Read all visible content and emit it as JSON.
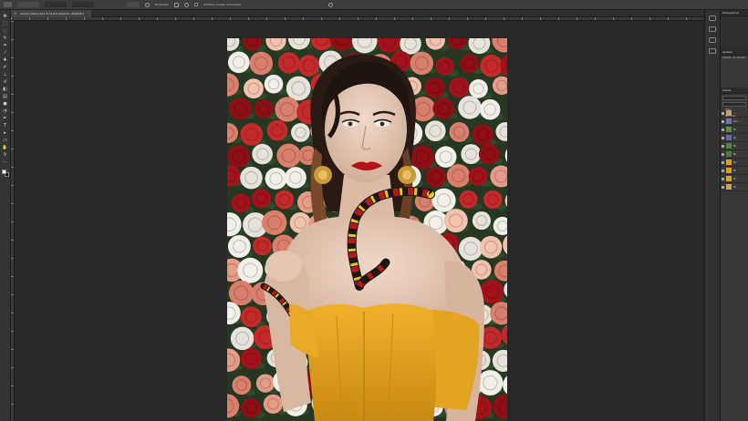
{
  "options_bar": {
    "tool_preset_label": "Proporción",
    "select_label": "Borrar",
    "straighten_label": "Enderezar",
    "checkbox_label": "Eliminar píxeles recortados"
  },
  "document": {
    "tab_title": "primer planos.psd al 33,4% (textura, RGB/16*)"
  },
  "tools": [
    {
      "icon": "move-icon",
      "glyph": "✥"
    },
    {
      "icon": "marquee-icon",
      "glyph": "⬚"
    },
    {
      "icon": "lasso-icon",
      "glyph": "◌"
    },
    {
      "icon": "quick-select-icon",
      "glyph": "✎"
    },
    {
      "icon": "crop-icon",
      "glyph": "⌗"
    },
    {
      "icon": "eyedropper-icon",
      "glyph": "⁄"
    },
    {
      "icon": "healing-icon",
      "glyph": "✚"
    },
    {
      "icon": "brush-icon",
      "glyph": "✐"
    },
    {
      "icon": "stamp-icon",
      "glyph": "⊥"
    },
    {
      "icon": "history-brush-icon",
      "glyph": "↺"
    },
    {
      "icon": "eraser-icon",
      "glyph": "◧"
    },
    {
      "icon": "gradient-icon",
      "glyph": "▤"
    },
    {
      "icon": "blur-icon",
      "glyph": "●"
    },
    {
      "icon": "dodge-icon",
      "glyph": "◔"
    },
    {
      "icon": "pen-icon",
      "glyph": "✒"
    },
    {
      "icon": "type-icon",
      "glyph": "T"
    },
    {
      "icon": "path-select-icon",
      "glyph": "▸"
    },
    {
      "icon": "shape-icon",
      "glyph": "▭"
    },
    {
      "icon": "hand-icon",
      "glyph": "✋"
    },
    {
      "icon": "zoom-icon",
      "glyph": "⚲"
    },
    {
      "icon": "more-tools-icon",
      "glyph": "⋯"
    }
  ],
  "swatches": {
    "foreground": "#ffffff",
    "background": "#000000"
  },
  "right_panel": {
    "top_tab": "Histograma",
    "section_a": "Ajustes",
    "section_b": "Añadir un ajuste",
    "layers_tab": "Capas",
    "kind_label": "Tipo",
    "mode_label": "Normal",
    "layers": [
      {
        "name": "...",
        "color": "#c9a063"
      },
      {
        "name": "tex",
        "color": "#7a6fb5"
      },
      {
        "name": "Ni",
        "color": "#5a8a47"
      },
      {
        "name": "Ni",
        "color": "#6e5fb0"
      },
      {
        "name": "Ni",
        "color": "#4e8a3d"
      },
      {
        "name": "Ni",
        "color": "#4d7c3a"
      },
      {
        "name": "Ni",
        "color": "#d9a027"
      },
      {
        "name": "Ni",
        "color": "#d99a26"
      },
      {
        "name": "Ni",
        "color": "#d9a027"
      },
      {
        "name": "Ni",
        "color": "#c9a063"
      }
    ]
  },
  "colors": {
    "app_bg": "#282828",
    "panel_bg": "#383838",
    "dress": "#e3a521",
    "lips": "#b5121b",
    "snake_red": "#b01c1c",
    "snake_yellow": "#e6c21c"
  }
}
